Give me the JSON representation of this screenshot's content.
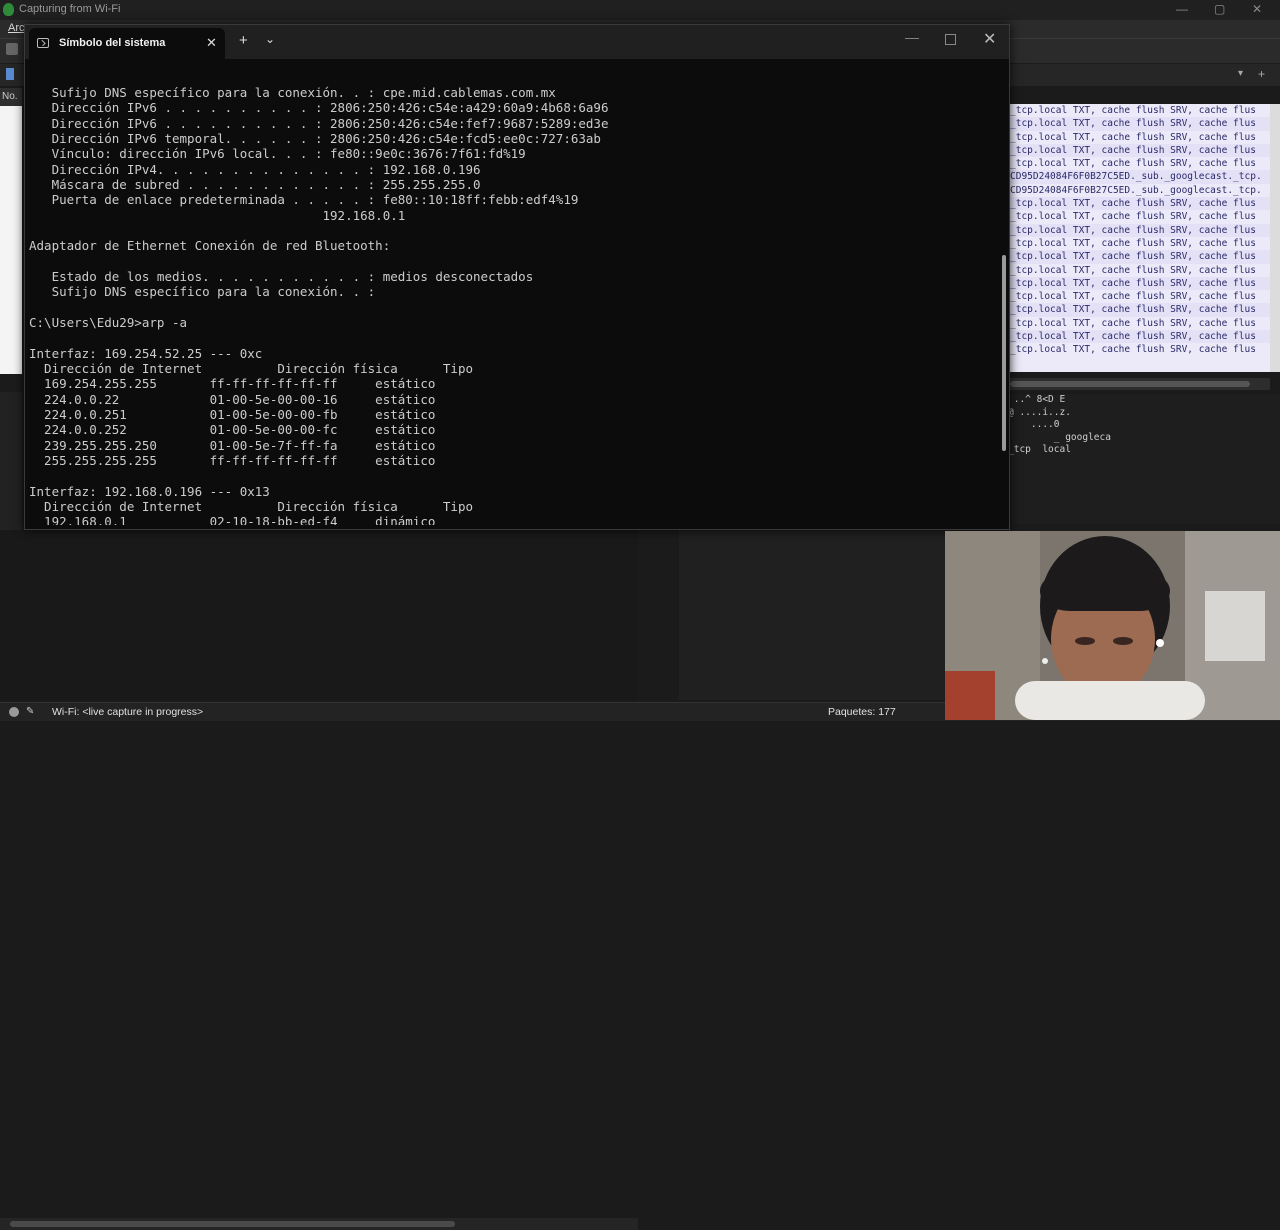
{
  "wireshark": {
    "title": "Capturing from Wi-Fi",
    "menu_fragment": "Arc",
    "column_fragment": "No.",
    "packet_rows": [
      "_tcp.local TXT, cache flush SRV, cache flus",
      "_tcp.local TXT, cache flush SRV, cache flus",
      "_tcp.local TXT, cache flush SRV, cache flus",
      "_tcp.local TXT, cache flush SRV, cache flus",
      "_tcp.local TXT, cache flush SRV, cache flus",
      "CD95D24084F6F0B27C5ED._sub._googlecast._tcp.",
      "CD95D24084F6F0B27C5ED._sub._googlecast._tcp.",
      "_tcp.local TXT, cache flush SRV, cache flus",
      "_tcp.local TXT, cache flush SRV, cache flus",
      "_tcp.local TXT, cache flush SRV, cache flus",
      "_tcp.local TXT, cache flush SRV, cache flus",
      "_tcp.local TXT, cache flush SRV, cache flus",
      "_tcp.local TXT, cache flush SRV, cache flus",
      "_tcp.local TXT, cache flush SRV, cache flus",
      "_tcp.local TXT, cache flush SRV, cache flus",
      "_tcp.local TXT, cache flush SRV, cache flus",
      "_tcp.local TXT, cache flush SRV, cache flus",
      "_tcp.local TXT, cache flush SRV, cache flus",
      "_tcp.local TXT, cache flush SRV, cache flus"
    ],
    "bytes_rows": [
      " ..^ 8<D E",
      "@ ....i..z.",
      "    ....0",
      "        _ googleca",
      "_tcp  local"
    ],
    "status_text": "Wi-Fi: <live capture in progress>",
    "packets_text": "Paquetes: 177"
  },
  "terminal": {
    "tab_title": "Símbolo del sistema",
    "lines": [
      "   Sufijo DNS específico para la conexión. . : cpe.mid.cablemas.com.mx",
      "   Dirección IPv6 . . . . . . . . . . : 2806:250:426:c54e:a429:60a9:4b68:6a96",
      "   Dirección IPv6 . . . . . . . . . . : 2806:250:426:c54e:fef7:9687:5289:ed3e",
      "   Dirección IPv6 temporal. . . . . . : 2806:250:426:c54e:fcd5:ee0c:727:63ab",
      "   Vínculo: dirección IPv6 local. . . : fe80::9e0c:3676:7f61:fd%19",
      "   Dirección IPv4. . . . . . . . . . . . . . : 192.168.0.196",
      "   Máscara de subred . . . . . . . . . . . . : 255.255.255.0",
      "   Puerta de enlace predeterminada . . . . . : fe80::10:18ff:febb:edf4%19",
      "                                       192.168.0.1",
      "",
      "Adaptador de Ethernet Conexión de red Bluetooth:",
      "",
      "   Estado de los medios. . . . . . . . . . . : medios desconectados",
      "   Sufijo DNS específico para la conexión. . :",
      "",
      "C:\\Users\\Edu29>arp -a",
      "",
      "Interfaz: 169.254.52.25 --- 0xc",
      "  Dirección de Internet          Dirección física      Tipo",
      "  169.254.255.255       ff-ff-ff-ff-ff-ff     estático",
      "  224.0.0.22            01-00-5e-00-00-16     estático",
      "  224.0.0.251           01-00-5e-00-00-fb     estático",
      "  224.0.0.252           01-00-5e-00-00-fc     estático",
      "  239.255.255.250       01-00-5e-7f-ff-fa     estático",
      "  255.255.255.255       ff-ff-ff-ff-ff-ff     estático",
      "",
      "Interfaz: 192.168.0.196 --- 0x13",
      "  Dirección de Internet          Dirección física      Tipo",
      "  192.168.0.1           02-10-18-bb-ed-f4     dinámico"
    ]
  },
  "colors": {
    "terminal_bg": "#0c0c0c",
    "terminal_text": "#cccccc",
    "packet_row_bg": "#eceaf8",
    "packet_text": "#2a2a6a"
  }
}
